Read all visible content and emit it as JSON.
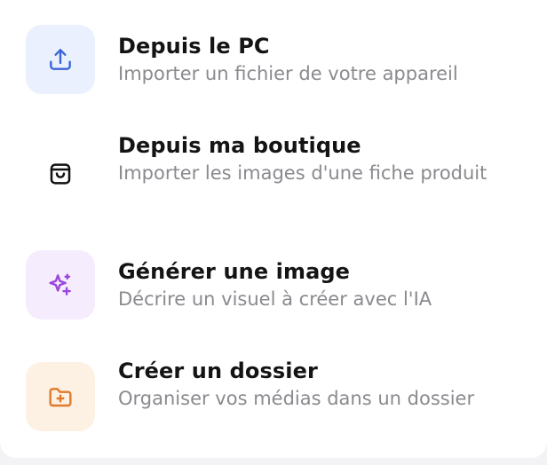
{
  "menu": {
    "items": [
      {
        "title": "Depuis le PC",
        "description": "Importer un fichier de votre appareil",
        "icon": "upload-icon",
        "icon_color": "#3a66d8",
        "background": "#eaf0fd"
      },
      {
        "title": "Depuis ma boutique",
        "description": "Importer les images d'une fiche produit",
        "icon": "shopping-bag-icon",
        "icon_color": "#111111",
        "background": "#ffffff"
      },
      {
        "title": "Générer une image",
        "description": "Décrire un visuel à créer avec l'IA",
        "icon": "sparkles-icon",
        "icon_color": "#9b45dd",
        "background": "#f5ecfd"
      },
      {
        "title": "Créer un dossier",
        "description": "Organiser vos médias dans un dossier",
        "icon": "folder-plus-icon",
        "icon_color": "#e07a2b",
        "background": "#fdf1e3"
      }
    ]
  }
}
